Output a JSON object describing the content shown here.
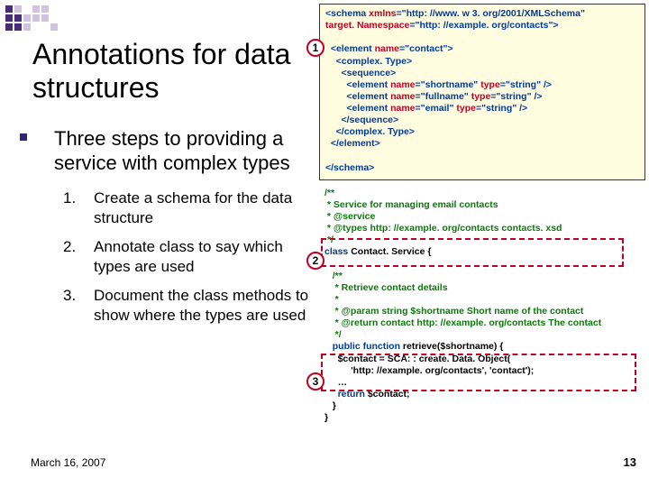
{
  "title": "Annotations for data structures",
  "subtitle": "Three steps to providing a service with complex types",
  "steps": [
    {
      "n": "1.",
      "t": "Create a schema for the data structure"
    },
    {
      "n": "2.",
      "t": "Annotate class to say which types are used"
    },
    {
      "n": "3.",
      "t": "Document the class methods to show where the types are used"
    }
  ],
  "date": "March 16, 2007",
  "page": "13",
  "callouts": {
    "c1": "1",
    "c2": "2",
    "c3": "3"
  },
  "code1": {
    "l1a": "<schema ",
    "l1b": "xmlns",
    "l1c": "=\"http: //www. w 3. org/2001/XMLSchema\"",
    "l2a": "target. Namespace",
    "l2b": "=\"http: //example. org/contacts\">",
    "l3a": "  <element ",
    "l3b": "name",
    "l3c": "=\"contact\">",
    "l4": "    <complex. Type>",
    "l5": "      <sequence>",
    "l6a": "        <element ",
    "l6b": "name",
    "l6c": "=\"shortname\" ",
    "l6d": "type",
    "l6e": "=\"string\" />",
    "l7a": "        <element ",
    "l7b": "name",
    "l7c": "=\"fullname\" ",
    "l7d": "type",
    "l7e": "=\"string\" />",
    "l8a": "        <element ",
    "l8b": "name",
    "l8c": "=\"email\" ",
    "l8d": "type",
    "l8e": "=\"string\" />",
    "l9": "      </sequence>",
    "l10": "    </complex. Type>",
    "l11": "  </element>",
    "l12": "</schema>"
  },
  "code2": {
    "l1": "/**",
    "l2": " * Service for managing email contacts",
    "l3": " * @service",
    "l4": " * @types http: //example. org/contacts contacts. xsd",
    "l5": " */",
    "l6a": "class",
    "l6b": " Contact. Service {",
    "l7": "   /**",
    "l8": "    * Retrieve contact details",
    "l9": "    *",
    "l10": "    * @param string $shortname Short name of the contact",
    "l11": "    * @return contact http: //example. org/contacts The contact",
    "l12": "    */",
    "l13a": "   public function",
    "l13b": " retrieve($shortname) {",
    "l14": "     $contact = SCA: : create. Data. Object(",
    "l15": "          'http: //example. org/contacts', 'contact');",
    "l16": "     …",
    "l17a": "     return ",
    "l17b": "$contact;",
    "l18": "   }",
    "l19": "}"
  }
}
